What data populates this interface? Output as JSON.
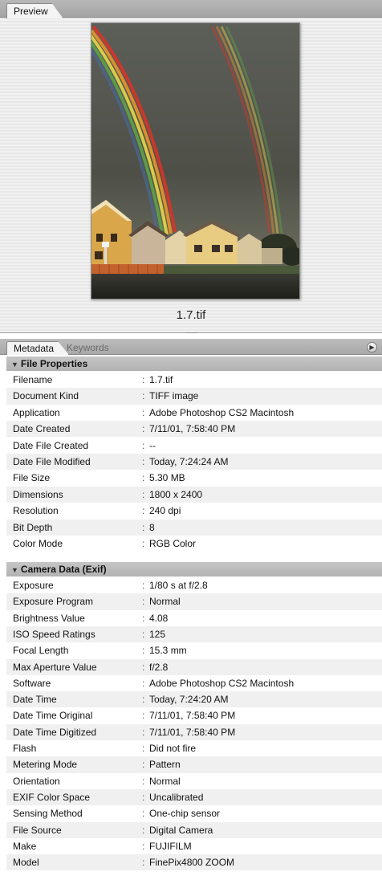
{
  "preview": {
    "tab_label": "Preview",
    "caption": "1.7.tif"
  },
  "metadata_panel": {
    "tabs": [
      {
        "label": "Metadata",
        "active": true
      },
      {
        "label": "Keywords",
        "active": false
      }
    ],
    "menu_icon": "triangle-right-icon"
  },
  "sections": {
    "file_properties": {
      "title": "File Properties",
      "rows": [
        {
          "label": "Filename",
          "value": "1.7.tif"
        },
        {
          "label": "Document Kind",
          "value": "TIFF image"
        },
        {
          "label": "Application",
          "value": "Adobe Photoshop CS2 Macintosh"
        },
        {
          "label": "Date Created",
          "value": "7/11/01, 7:58:40 PM"
        },
        {
          "label": "Date File Created",
          "value": "--"
        },
        {
          "label": "Date File Modified",
          "value": "Today, 7:24:24 AM"
        },
        {
          "label": "File Size",
          "value": "5.30 MB"
        },
        {
          "label": "Dimensions",
          "value": "1800 x 2400"
        },
        {
          "label": "Resolution",
          "value": "240 dpi"
        },
        {
          "label": "Bit Depth",
          "value": "8"
        },
        {
          "label": "Color Mode",
          "value": "RGB Color"
        }
      ]
    },
    "camera_data": {
      "title": "Camera Data (Exif)",
      "rows": [
        {
          "label": "Exposure",
          "value": "1/80 s at f/2.8"
        },
        {
          "label": "Exposure Program",
          "value": "Normal"
        },
        {
          "label": "Brightness Value",
          "value": "4.08"
        },
        {
          "label": "ISO Speed Ratings",
          "value": "125"
        },
        {
          "label": "Focal Length",
          "value": "15.3 mm"
        },
        {
          "label": "Max Aperture Value",
          "value": "f/2.8"
        },
        {
          "label": "Software",
          "value": "Adobe Photoshop CS2 Macintosh"
        },
        {
          "label": "Date Time",
          "value": "Today, 7:24:20 AM"
        },
        {
          "label": "Date Time Original",
          "value": "7/11/01, 7:58:40 PM"
        },
        {
          "label": "Date Time Digitized",
          "value": "7/11/01, 7:58:40 PM"
        },
        {
          "label": "Flash",
          "value": "Did not fire"
        },
        {
          "label": "Metering Mode",
          "value": "Pattern"
        },
        {
          "label": "Orientation",
          "value": "Normal"
        },
        {
          "label": "EXIF Color Space",
          "value": "Uncalibrated"
        },
        {
          "label": "Sensing Method",
          "value": "One-chip sensor"
        },
        {
          "label": "File Source",
          "value": "Digital Camera"
        },
        {
          "label": "Make",
          "value": "FUJIFILM"
        },
        {
          "label": "Model",
          "value": "FinePix4800 ZOOM"
        }
      ]
    }
  },
  "colors": {
    "section_header_bg": "#bcbcbc",
    "row_alt_bg": "#f0f0f0",
    "panel_bg": "#ededed"
  }
}
